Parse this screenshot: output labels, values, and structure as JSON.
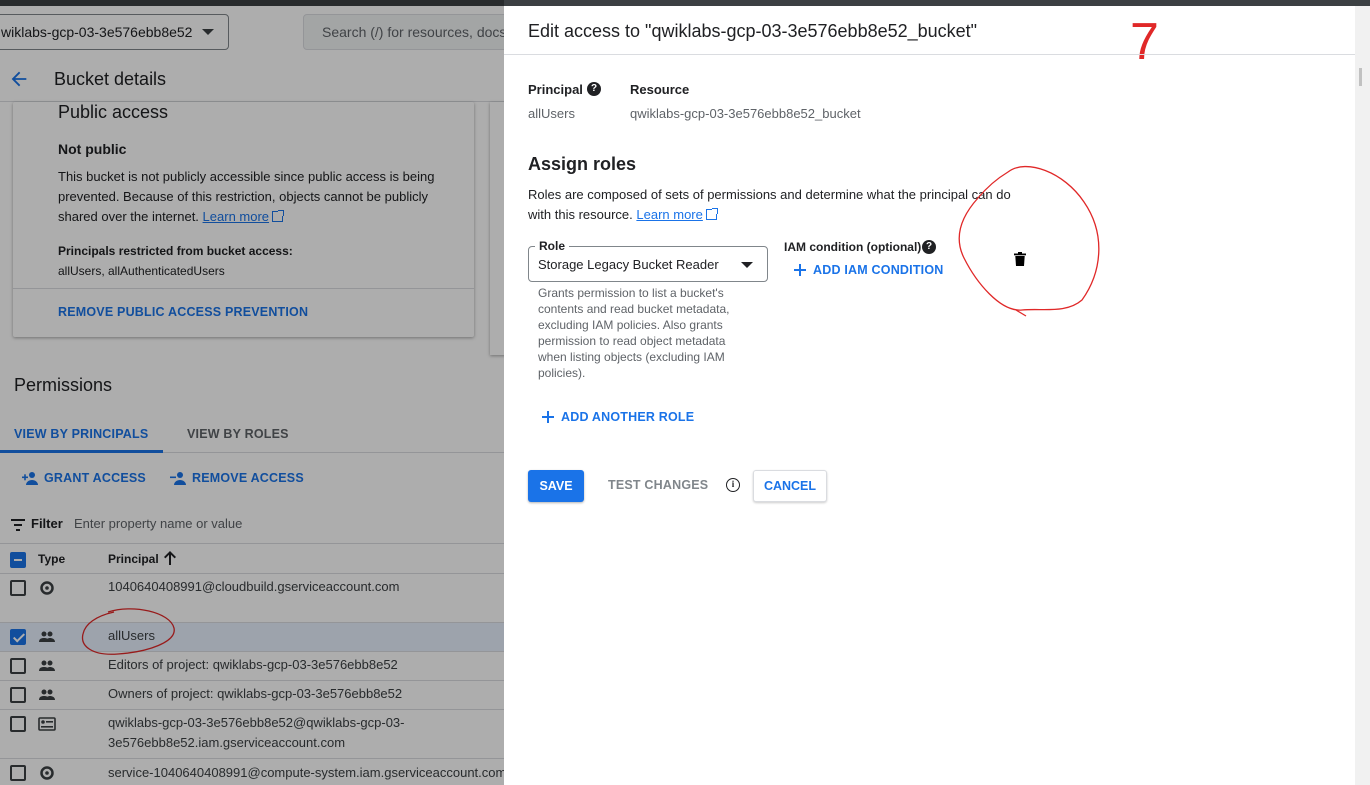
{
  "topbar": {
    "project": "wiklabs-gcp-03-3e576ebb8e52",
    "search_placeholder": "Search (/) for resources, docs"
  },
  "page": {
    "title": "Bucket details"
  },
  "public_access": {
    "heading": "Public access",
    "status": "Not public",
    "description": "This bucket is not publicly accessible since public access is being prevented. Because of this restriction, objects cannot be publicly shared over the internet.",
    "learn_more": "Learn more",
    "restricted_label": "Principals restricted from bucket access:",
    "restricted_value": "allUsers, allAuthenticatedUsers",
    "remove_button": "REMOVE PUBLIC ACCESS PREVENTION"
  },
  "permissions": {
    "title": "Permissions",
    "tabs": [
      "VIEW BY PRINCIPALS",
      "VIEW BY ROLES"
    ],
    "grant_access": "GRANT ACCESS",
    "remove_access": "REMOVE ACCESS",
    "filter_label": "Filter",
    "filter_placeholder": "Enter property name or value",
    "columns": [
      "Type",
      "Principal"
    ],
    "rows": [
      {
        "principal": "1040640408991@cloudbuild.gserviceaccount.com",
        "type": "service-account",
        "checked": false
      },
      {
        "principal": "allUsers",
        "type": "group",
        "checked": true
      },
      {
        "principal": "Editors of project: qwiklabs-gcp-03-3e576ebb8e52",
        "type": "group",
        "checked": false
      },
      {
        "principal": "Owners of project: qwiklabs-gcp-03-3e576ebb8e52",
        "type": "group",
        "checked": false
      },
      {
        "principal": "qwiklabs-gcp-03-3e576ebb8e52@qwiklabs-gcp-03-3e576ebb8e52.iam.gserviceaccount.com",
        "type": "service-account-key",
        "checked": false
      },
      {
        "principal": "service-1040640408991@compute-system.iam.gserviceaccount.com",
        "type": "service-account",
        "checked": false
      }
    ]
  },
  "panel": {
    "title": "Edit access to \"qwiklabs-gcp-03-3e576ebb8e52_bucket\"",
    "annotation_number": "7",
    "principal_label": "Principal",
    "principal_value": "allUsers",
    "resource_label": "Resource",
    "resource_value": "qwiklabs-gcp-03-3e576ebb8e52_bucket",
    "assign_title": "Assign roles",
    "assign_desc": "Roles are composed of sets of permissions and determine what the principal can do with this resource.",
    "learn_more": "Learn more",
    "role_label": "Role",
    "role_value": "Storage Legacy Bucket Reader",
    "role_help": "Grants permission to list a bucket's contents and read bucket metadata, excluding IAM policies. Also grants permission to read object metadata when listing objects (excluding IAM policies).",
    "iam_condition_label": "IAM condition (optional)",
    "add_iam_condition": "ADD IAM CONDITION",
    "add_another_role": "ADD ANOTHER ROLE",
    "save": "SAVE",
    "test_changes": "TEST CHANGES",
    "cancel": "CANCEL"
  },
  "colors": {
    "accent": "#1a73e8",
    "annotation": "#e02828"
  }
}
